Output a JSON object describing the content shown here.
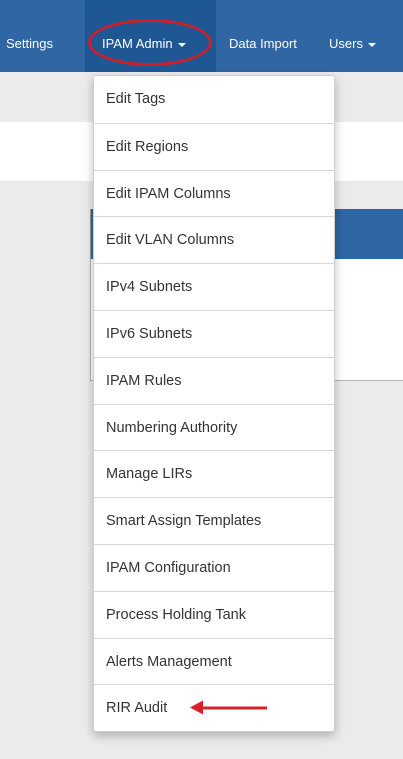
{
  "navbar": {
    "items": [
      {
        "label": "Settings"
      },
      {
        "label": "IPAM Admin"
      },
      {
        "label": "Data Import"
      },
      {
        "label": "Users"
      }
    ]
  },
  "dropdown": {
    "items": [
      {
        "label": "Edit Tags"
      },
      {
        "label": "Edit Regions"
      },
      {
        "label": "Edit IPAM Columns"
      },
      {
        "label": "Edit VLAN Columns"
      },
      {
        "label": "IPv4 Subnets"
      },
      {
        "label": "IPv6 Subnets"
      },
      {
        "label": "IPAM Rules"
      },
      {
        "label": "Numbering Authority"
      },
      {
        "label": "Manage LIRs"
      },
      {
        "label": "Smart Assign Templates"
      },
      {
        "label": "IPAM Configuration"
      },
      {
        "label": "Process Holding Tank"
      },
      {
        "label": "Alerts Management"
      },
      {
        "label": "RIR Audit"
      }
    ]
  },
  "colors": {
    "navbar": "#2f66a3",
    "annotation": "#d8202a"
  }
}
